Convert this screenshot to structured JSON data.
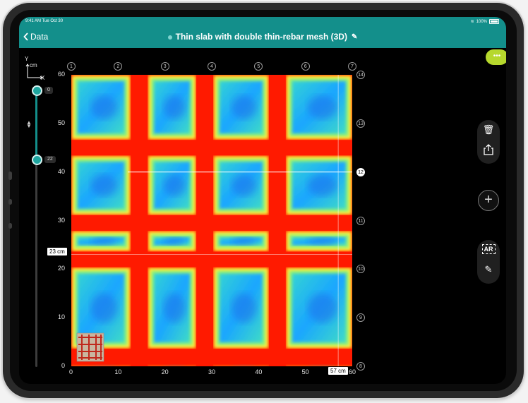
{
  "status_bar": {
    "time": "9:41 AM",
    "date": "Tue Oct 30",
    "battery": "100%"
  },
  "nav": {
    "back_label": "Data",
    "title": "Thin slab with double thin-rebar mesh (3D)",
    "more_label": "•••"
  },
  "axes": {
    "y_label": "Y",
    "unit": "cm",
    "x_label": "X"
  },
  "slider": {
    "top_value": "0",
    "bottom_value": "22",
    "updown_glyph": "▲▼"
  },
  "x_ticks": [
    "0",
    "10",
    "20",
    "30",
    "40",
    "50",
    "60"
  ],
  "y_ticks": [
    "60",
    "50",
    "40",
    "30",
    "20",
    "10",
    "0"
  ],
  "top_lines": [
    "1",
    "2",
    "3",
    "4",
    "5",
    "6",
    "7"
  ],
  "right_lines": [
    "14",
    "13",
    "12",
    "11",
    "10",
    "9",
    "8"
  ],
  "active_line": "12",
  "cursor": {
    "y_readout": "23 cm",
    "x_readout": "57 cm"
  },
  "tools": {
    "delete_icon": "🗑",
    "share_icon": "⇪",
    "add_icon": "+",
    "ar_label": "AR",
    "annotate_icon": "✎"
  },
  "colors": {
    "accent": "#138f8b",
    "more": "#b6d82d",
    "rebar_hot": "#ff1a00",
    "background_cold": "#1ea7ff"
  },
  "chart_data": {
    "type": "heatmap",
    "x_range": [
      0,
      60
    ],
    "y_range": [
      0,
      60
    ],
    "unit": "cm",
    "rebar_x_positions_cm": [
      14.5,
      28.5,
      44
    ],
    "rebar_y_positions_cm": [
      2,
      22,
      29.5,
      45
    ],
    "cursor_lines_cm": {
      "x": 57,
      "y": 23,
      "y_active": 40
    }
  }
}
